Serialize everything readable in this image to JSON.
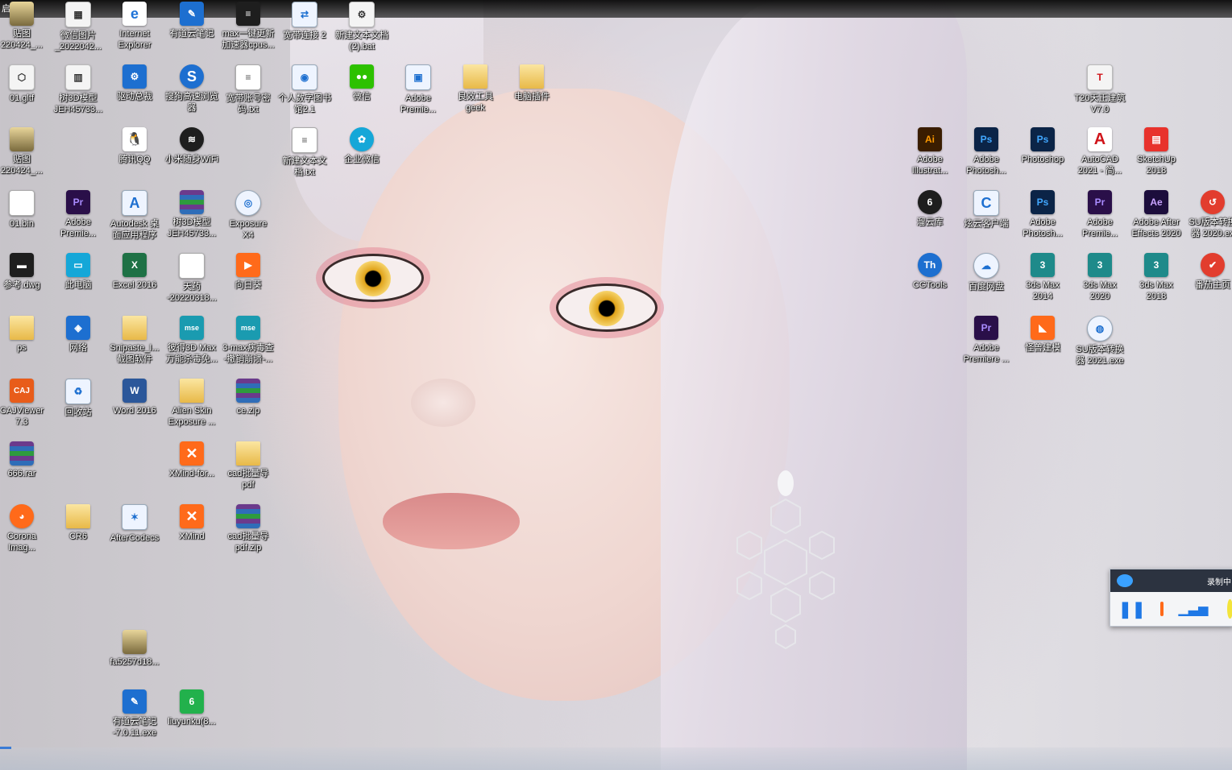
{
  "topbar": {
    "label": "启动"
  },
  "icons": [
    {
      "label": "贴图\n220424_...",
      "icon": "image-icon"
    },
    {
      "label": "微信图片\n_2022042...",
      "icon": "image-icon"
    },
    {
      "label": "Internet\nExplorer",
      "icon": "internet-explorer-icon"
    },
    {
      "label": "有道云笔记",
      "icon": "youdao-note-icon"
    },
    {
      "label": "max一键更新\n加速器cpus...",
      "icon": "exe-icon"
    },
    {
      "label": "宽带连接 2",
      "icon": "network-connection-icon"
    },
    {
      "label": "新建文本文档\n(2).bat",
      "icon": "batch-file-icon"
    },
    {
      "label": "01.gltf",
      "icon": "gltf-file-icon"
    },
    {
      "label": "树3D模型\nJEH45733...",
      "icon": "image-icon"
    },
    {
      "label": "驱动总裁",
      "icon": "driver-icon"
    },
    {
      "label": "搜狗高速浏览\n器",
      "icon": "sogou-browser-icon"
    },
    {
      "label": "宽带账号密\n码.txt",
      "icon": "text-file-icon"
    },
    {
      "label": "个人数字图书\n馆2.1",
      "icon": "library-icon"
    },
    {
      "label": "微信",
      "icon": "wechat-icon"
    },
    {
      "label": "Adobe\nPremie...",
      "icon": "adobe-premiere-icon"
    },
    {
      "label": "良效工具\ngeek",
      "icon": "geek-tool-icon"
    },
    {
      "label": "电脑插件",
      "icon": "folder-icon"
    },
    {
      "label": "贴图\n220424_...",
      "icon": "image-icon"
    },
    {
      "label": "腾讯QQ",
      "icon": "qq-icon"
    },
    {
      "label": "小米随身WiFi",
      "icon": "wifi-icon"
    },
    {
      "label": "新建文本文\n档.txt",
      "icon": "text-file-icon"
    },
    {
      "label": "企业微信",
      "icon": "wecom-icon"
    },
    {
      "label": "01.bin",
      "icon": "bin-file-icon"
    },
    {
      "label": "Adobe\nPremie...",
      "icon": "adobe-premiere-icon"
    },
    {
      "label": "Autodesk 桌\n面应用程序",
      "icon": "autodesk-icon"
    },
    {
      "label": "树3D模型\nJEH45733...",
      "icon": "zip-archive-icon"
    },
    {
      "label": "Exposure\nX4",
      "icon": "exposure-icon"
    },
    {
      "label": "参考.dwg",
      "icon": "dwg-file-icon"
    },
    {
      "label": "此电脑",
      "icon": "this-pc-icon"
    },
    {
      "label": "Excel 2016",
      "icon": "excel-icon"
    },
    {
      "label": "天药\n-20220318...",
      "icon": "document-icon"
    },
    {
      "label": "向日葵",
      "icon": "sunflower-remote-icon"
    },
    {
      "label": "ps",
      "icon": "folder-icon"
    },
    {
      "label": "网络",
      "icon": "network-icon"
    },
    {
      "label": "Snipaste_I...\n截图软件",
      "icon": "folder-icon"
    },
    {
      "label": "彼得3D Max\n万能杀毒免...",
      "icon": "mse-installer-icon"
    },
    {
      "label": "3-max病毒查\n-撤销崩溃-...",
      "icon": "mse-installer-icon"
    },
    {
      "label": "CAJViewer\n7.3",
      "icon": "cajviewer-icon"
    },
    {
      "label": "回收站",
      "icon": "recycle-bin-icon"
    },
    {
      "label": "Word 2016",
      "icon": "word-icon"
    },
    {
      "label": "Alien Skin\nExposure ...",
      "icon": "installer-icon"
    },
    {
      "label": "ce.zip",
      "icon": "zip-archive-icon"
    },
    {
      "label": "666.rar",
      "icon": "rar-archive-icon"
    },
    {
      "label": "XMind-for...",
      "icon": "xmind-icon"
    },
    {
      "label": "cad批量导\npdf",
      "icon": "folder-icon"
    },
    {
      "label": "Corona\nImag...",
      "icon": "corona-image-icon"
    },
    {
      "label": "CR6",
      "icon": "folder-icon"
    },
    {
      "label": "AfterCodecs",
      "icon": "aftercodecs-icon"
    },
    {
      "label": "XMind",
      "icon": "xmind-icon"
    },
    {
      "label": "cad批量导\npdf.zip",
      "icon": "zip-archive-icon"
    },
    {
      "label": "fa5257d18...",
      "icon": "image-icon"
    },
    {
      "label": "有道云笔记\n-7.0.11.exe",
      "icon": "youdao-installer-icon"
    },
    {
      "label": "liuyunku(8...",
      "icon": "liuyunku-icon"
    },
    {
      "label": "T20天正建筑\nV7.0",
      "icon": "tangent-arch-icon"
    },
    {
      "label": "Adobe\nIllustrat...",
      "icon": "adobe-illustrator-icon"
    },
    {
      "label": "Adobe\nPhotosh...",
      "icon": "adobe-photoshop-icon"
    },
    {
      "label": "Photoshop",
      "icon": "adobe-photoshop-icon"
    },
    {
      "label": "AutoCAD\n2021 - 简...",
      "icon": "autocad-icon"
    },
    {
      "label": "SketchUp\n2018",
      "icon": "sketchup-icon"
    },
    {
      "label": "溜云库",
      "icon": "liuyunku-icon"
    },
    {
      "label": "炫云客户端",
      "icon": "xuanyun-icon"
    },
    {
      "label": "Adobe\nPhotosh...",
      "icon": "adobe-photoshop-icon"
    },
    {
      "label": "Adobe\nPremie...",
      "icon": "adobe-premiere-icon"
    },
    {
      "label": "Adobe After\nEffects 2020",
      "icon": "adobe-after-effects-icon"
    },
    {
      "label": "SU版本转换\n器 2020.ex",
      "icon": "sketchup-converter-icon"
    },
    {
      "label": "CGTools",
      "icon": "cgtools-icon"
    },
    {
      "label": "百度网盘",
      "icon": "baidu-netdisk-icon"
    },
    {
      "label": "3ds Max\n2014",
      "icon": "3ds-max-icon"
    },
    {
      "label": "3ds Max\n2020",
      "icon": "3ds-max-icon"
    },
    {
      "label": "3ds Max\n2018",
      "icon": "3ds-max-icon"
    },
    {
      "label": "番茄主页",
      "icon": "tomato-icon"
    },
    {
      "label": "Adobe\nPremiere ...",
      "icon": "adobe-premiere-icon"
    },
    {
      "label": "怪兽建模",
      "icon": "monster-model-icon"
    },
    {
      "label": "SU版本转换\n器 2021.exe",
      "icon": "sketchup-converter-icon"
    }
  ],
  "recorder": {
    "title": "录制中"
  }
}
